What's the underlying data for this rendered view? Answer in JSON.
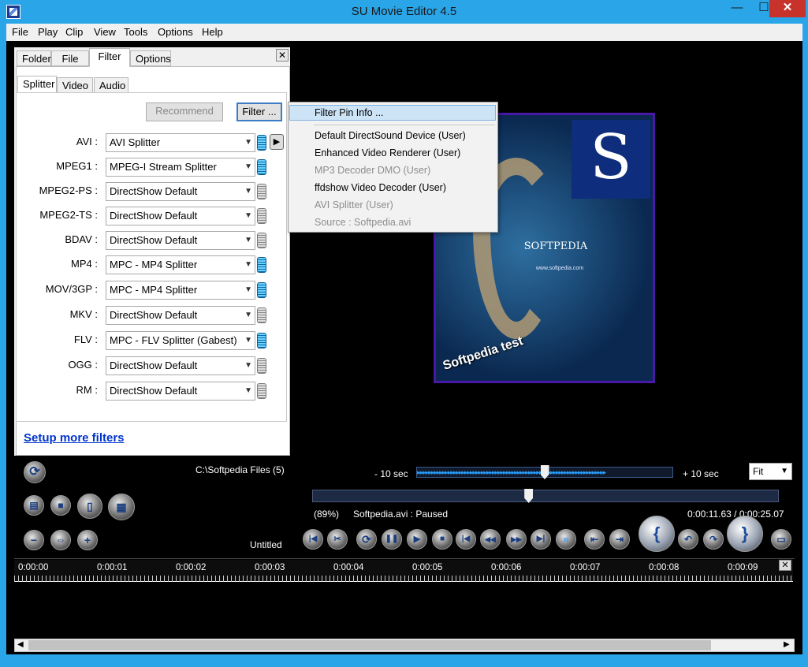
{
  "window": {
    "title": "SU Movie Editor 4.5",
    "minimize": "—",
    "maximize": "☐",
    "close": "✕"
  },
  "menu": [
    "File",
    "Play",
    "Clip",
    "View",
    "Tools",
    "Options",
    "Help"
  ],
  "tabs": [
    "Folder",
    "File",
    "Filter",
    "Options"
  ],
  "subtabs": [
    "Splitter",
    "Video",
    "Audio"
  ],
  "buttons": {
    "recommend": "Recommend",
    "filter": "Filter ..."
  },
  "splitters": [
    {
      "label": "AVI :",
      "value": "AVI Splitter",
      "active": true
    },
    {
      "label": "MPEG1 :",
      "value": "MPEG-I Stream Splitter",
      "active": true
    },
    {
      "label": "MPEG2-PS :",
      "value": "DirectShow Default",
      "active": false
    },
    {
      "label": "MPEG2-TS :",
      "value": "DirectShow Default",
      "active": false
    },
    {
      "label": "BDAV :",
      "value": "DirectShow Default",
      "active": false
    },
    {
      "label": "MP4 :",
      "value": "MPC - MP4 Splitter",
      "active": true
    },
    {
      "label": "MOV/3GP :",
      "value": "MPC - MP4 Splitter",
      "active": true
    },
    {
      "label": "MKV :",
      "value": "DirectShow Default",
      "active": false
    },
    {
      "label": "FLV :",
      "value": "MPC - FLV Splitter (Gabest)",
      "active": true
    },
    {
      "label": "OGG :",
      "value": "DirectShow Default",
      "active": false
    },
    {
      "label": "RM :",
      "value": "DirectShow Default",
      "active": false
    }
  ],
  "setup_link": "Setup more filters",
  "popup": {
    "items": [
      {
        "text": "Filter Pin Info ...",
        "disabled": false
      },
      {
        "text": "Default DirectSound Device (User)",
        "disabled": false
      },
      {
        "text": "Enhanced Video Renderer (User)",
        "disabled": false
      },
      {
        "text": "MP3 Decoder DMO (User)",
        "disabled": true
      },
      {
        "text": "ffdshow Video Decoder (User)",
        "disabled": false
      },
      {
        "text": "AVI Splitter (User)",
        "disabled": true
      },
      {
        "text": "Source : Softpedia.avi",
        "disabled": true
      }
    ]
  },
  "poster": {
    "letter": "S",
    "brand": "SOFTPEDIA",
    "url": "www.softpedia.com",
    "caption": "Softpedia test"
  },
  "status": {
    "folder": "C:\\Softpedia Files (5)",
    "project": "Untitled",
    "percent": "(89%)",
    "file_state": "Softpedia.avi : Paused",
    "time": "0:00:11.63 / 0:00:25.07",
    "minus": "- 10 sec",
    "plus": "+ 10 sec",
    "zoom": "Fit"
  },
  "playback": {
    "position_fraction": 0.464,
    "jog_fraction": 0.5
  },
  "timeline": [
    "0:00:00",
    "0:00:01",
    "0:00:02",
    "0:00:03",
    "0:00:04",
    "0:00:05",
    "0:00:06",
    "0:00:07",
    "0:00:08",
    "0:00:09"
  ],
  "icons": {
    "refresh": "⟳",
    "open": "▤",
    "save": "■",
    "doc": "▯",
    "film": "▦",
    "zoom_out": "−",
    "fit": "⇔",
    "zoom_in": "+",
    "step_back": "|◀",
    "cut": "✂",
    "loop": "⟳",
    "pause": "❚❚",
    "play": "▶",
    "stop": "■",
    "first": "|◀",
    "rewind": "◀◀",
    "forward": "▶▶",
    "last": "▶|",
    "fast": "»",
    "mark_prev": "⇤",
    "mark_next": "⇥",
    "brace_open": "{",
    "brace_close": "}",
    "jump_in": "↶",
    "jump_out": "↷",
    "screen": "▭"
  }
}
